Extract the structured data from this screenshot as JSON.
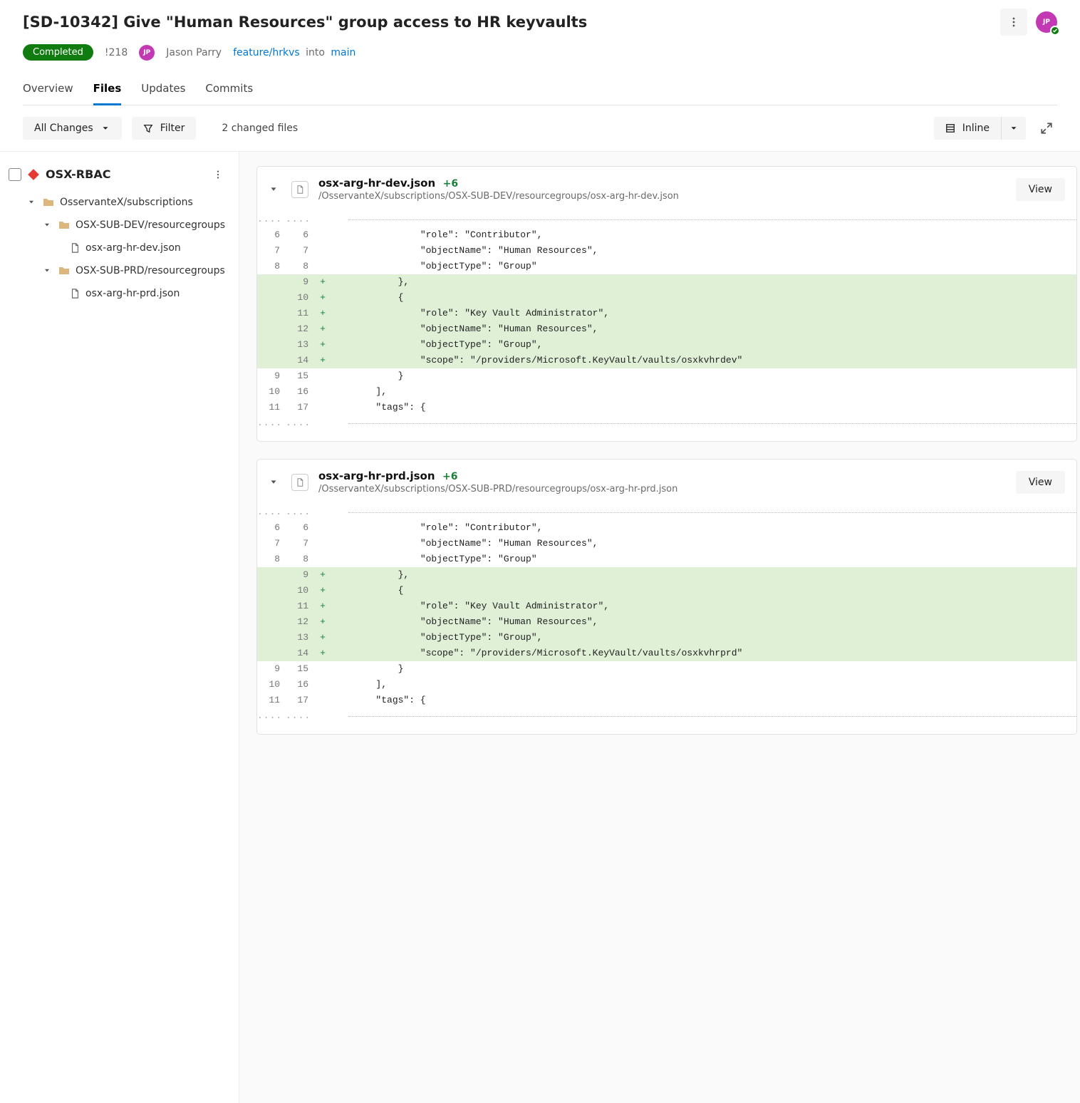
{
  "title": "[SD-10342] Give \"Human Resources\" group access to HR keyvaults",
  "status_badge": "Completed",
  "pr_id": "!218",
  "author": {
    "initials": "JP",
    "name": "Jason Parry"
  },
  "branch": {
    "source": "feature/hrkvs",
    "into": "into",
    "target": "main"
  },
  "tabs": [
    "Overview",
    "Files",
    "Updates",
    "Commits"
  ],
  "active_tab": "Files",
  "toolbar": {
    "all_changes": "All Changes",
    "filter": "Filter",
    "changed_files": "2 changed files",
    "inline": "Inline"
  },
  "sidebar": {
    "repo": "OSX-RBAC",
    "tree": {
      "root": "OsservanteX/subscriptions",
      "groups": [
        {
          "name": "OSX-SUB-DEV/resourcegroups",
          "files": [
            "osx-arg-hr-dev.json"
          ]
        },
        {
          "name": "OSX-SUB-PRD/resourcegroups",
          "files": [
            "osx-arg-hr-prd.json"
          ]
        }
      ]
    }
  },
  "view_button": "View",
  "files": [
    {
      "name": "osx-arg-hr-dev.json",
      "delta": "+6",
      "path": "/OsservanteX/subscriptions/OSX-SUB-DEV/resourcegroups/osx-arg-hr-dev.json",
      "lines": [
        {
          "old": "....",
          "new": "....",
          "marker": "",
          "code": "",
          "skip": true
        },
        {
          "old": "6",
          "new": "6",
          "marker": "",
          "code": "                \"role\": \"Contributor\","
        },
        {
          "old": "7",
          "new": "7",
          "marker": "",
          "code": "                \"objectName\": \"Human Resources\","
        },
        {
          "old": "8",
          "new": "8",
          "marker": "",
          "code": "                \"objectType\": \"Group\""
        },
        {
          "old": "",
          "new": "9",
          "marker": "+",
          "code": "            },",
          "added": true
        },
        {
          "old": "",
          "new": "10",
          "marker": "+",
          "code": "            {",
          "added": true
        },
        {
          "old": "",
          "new": "11",
          "marker": "+",
          "code": "                \"role\": \"Key Vault Administrator\",",
          "added": true
        },
        {
          "old": "",
          "new": "12",
          "marker": "+",
          "code": "                \"objectName\": \"Human Resources\",",
          "added": true
        },
        {
          "old": "",
          "new": "13",
          "marker": "+",
          "code": "                \"objectType\": \"Group\",",
          "added": true
        },
        {
          "old": "",
          "new": "14",
          "marker": "+",
          "code": "                \"scope\": \"/providers/Microsoft.KeyVault/vaults/osxkvhrdev\"",
          "added": true
        },
        {
          "old": "9",
          "new": "15",
          "marker": "",
          "code": "            }"
        },
        {
          "old": "10",
          "new": "16",
          "marker": "",
          "code": "        ],"
        },
        {
          "old": "11",
          "new": "17",
          "marker": "",
          "code": "        \"tags\": {"
        },
        {
          "old": "....",
          "new": "....",
          "marker": "",
          "code": "",
          "skip": true
        }
      ]
    },
    {
      "name": "osx-arg-hr-prd.json",
      "delta": "+6",
      "path": "/OsservanteX/subscriptions/OSX-SUB-PRD/resourcegroups/osx-arg-hr-prd.json",
      "lines": [
        {
          "old": "....",
          "new": "....",
          "marker": "",
          "code": "",
          "skip": true
        },
        {
          "old": "6",
          "new": "6",
          "marker": "",
          "code": "                \"role\": \"Contributor\","
        },
        {
          "old": "7",
          "new": "7",
          "marker": "",
          "code": "                \"objectName\": \"Human Resources\","
        },
        {
          "old": "8",
          "new": "8",
          "marker": "",
          "code": "                \"objectType\": \"Group\""
        },
        {
          "old": "",
          "new": "9",
          "marker": "+",
          "code": "            },",
          "added": true
        },
        {
          "old": "",
          "new": "10",
          "marker": "+",
          "code": "            {",
          "added": true
        },
        {
          "old": "",
          "new": "11",
          "marker": "+",
          "code": "                \"role\": \"Key Vault Administrator\",",
          "added": true
        },
        {
          "old": "",
          "new": "12",
          "marker": "+",
          "code": "                \"objectName\": \"Human Resources\",",
          "added": true
        },
        {
          "old": "",
          "new": "13",
          "marker": "+",
          "code": "                \"objectType\": \"Group\",",
          "added": true
        },
        {
          "old": "",
          "new": "14",
          "marker": "+",
          "code": "                \"scope\": \"/providers/Microsoft.KeyVault/vaults/osxkvhrprd\"",
          "added": true
        },
        {
          "old": "9",
          "new": "15",
          "marker": "",
          "code": "            }"
        },
        {
          "old": "10",
          "new": "16",
          "marker": "",
          "code": "        ],"
        },
        {
          "old": "11",
          "new": "17",
          "marker": "",
          "code": "        \"tags\": {"
        },
        {
          "old": "....",
          "new": "....",
          "marker": "",
          "code": "",
          "skip": true
        }
      ]
    }
  ]
}
